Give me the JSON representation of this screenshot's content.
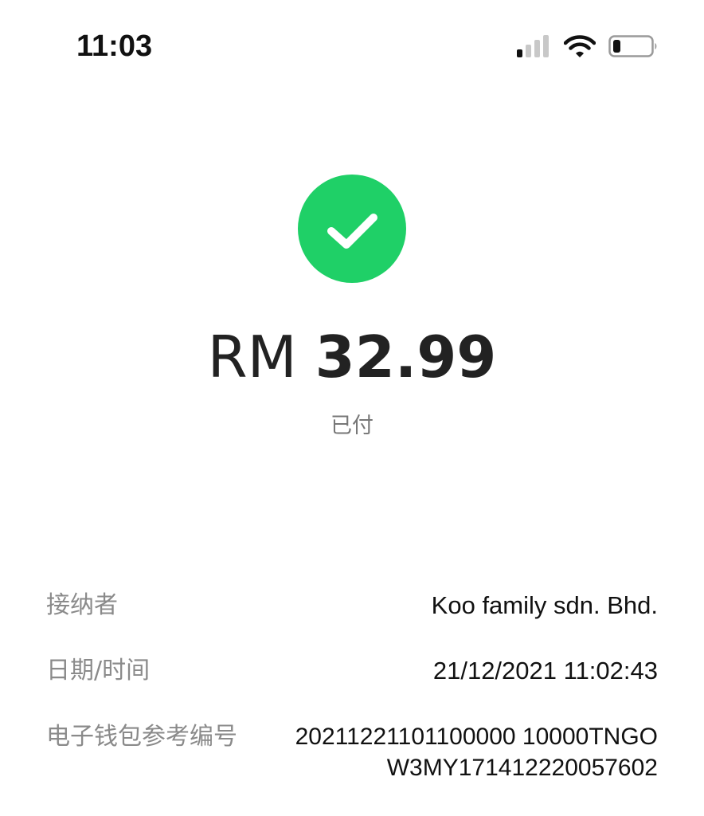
{
  "status_bar": {
    "time": "11:03",
    "icons": [
      "cellular-signal-icon",
      "wifi-icon",
      "battery-icon"
    ]
  },
  "payment": {
    "currency": "RM",
    "amount": "32.99",
    "status": "已付",
    "status_icon": "check-circle-icon",
    "accent_color": "#1fd067"
  },
  "details": {
    "recipient_label": "接纳者",
    "recipient_value": "Koo family sdn. Bhd.",
    "datetime_label": "日期/时间",
    "datetime_value": "21/12/2021 11:02:43",
    "reference_label": "电子钱包参考编号",
    "reference_value_line1": "20211221101100000 10000TNGO",
    "reference_value_line2": "W3MY171412220057602"
  }
}
